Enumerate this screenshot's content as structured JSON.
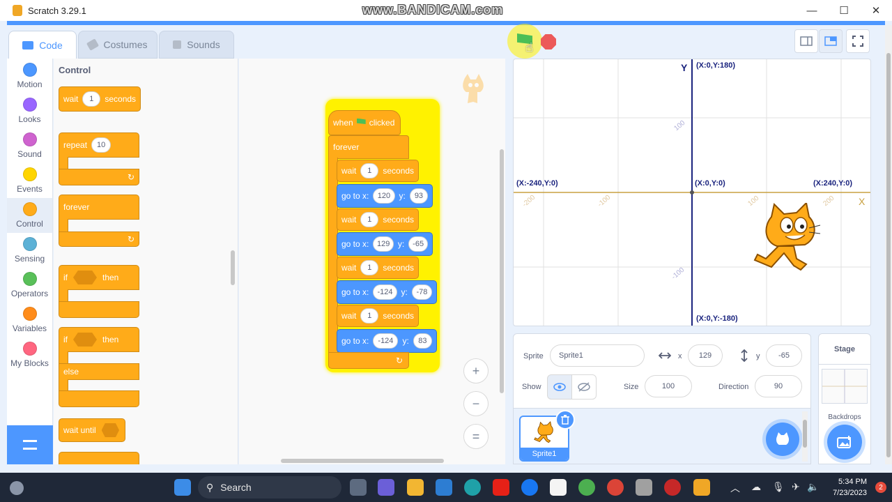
{
  "window": {
    "title": "Scratch 3.29.1",
    "watermark": "www.BANDICAM.com",
    "controls": {
      "minimize": "—",
      "maximize": "☐",
      "close": "✕"
    }
  },
  "tabs": [
    {
      "label": "Code",
      "icon": "code-icon"
    },
    {
      "label": "Costumes",
      "icon": "brush-icon"
    },
    {
      "label": "Sounds",
      "icon": "speaker-icon"
    }
  ],
  "categories": [
    {
      "label": "Motion",
      "color": "#4c97ff"
    },
    {
      "label": "Looks",
      "color": "#9966ff"
    },
    {
      "label": "Sound",
      "color": "#cf63cf"
    },
    {
      "label": "Events",
      "color": "#ffd500"
    },
    {
      "label": "Control",
      "color": "#ffab19"
    },
    {
      "label": "Sensing",
      "color": "#5cb1d6"
    },
    {
      "label": "Operators",
      "color": "#59c059"
    },
    {
      "label": "Variables",
      "color": "#ff8c1a"
    },
    {
      "label": "My Blocks",
      "color": "#ff6680"
    }
  ],
  "palette": {
    "title": "Control",
    "wait": {
      "pre": "wait",
      "value": "1",
      "post": "seconds"
    },
    "repeat": {
      "pre": "repeat",
      "value": "10"
    },
    "forever": "forever",
    "if_then": {
      "pre": "if",
      "post": "then"
    },
    "if_else": {
      "pre": "if",
      "post": "then",
      "else": "else"
    },
    "wait_until": "wait until",
    "loop_arrow": "↻"
  },
  "script": {
    "hat": {
      "pre": "when",
      "post": "clicked"
    },
    "forever": "forever",
    "wait_pre": "wait",
    "wait_post": "seconds",
    "goto_pre": "go to x:",
    "goto_y": "y:",
    "steps": [
      {
        "wait": "1",
        "x": "120",
        "y": "93"
      },
      {
        "wait": "1",
        "x": "129",
        "y": "-65"
      },
      {
        "wait": "1",
        "x": "-124",
        "y": "-78"
      },
      {
        "wait": "1",
        "x": "-124",
        "y": "83"
      }
    ],
    "loop_arrow": "↻"
  },
  "zoom": {
    "in": "+",
    "out": "−",
    "reset": "="
  },
  "stage": {
    "labels": {
      "y_axis": "Y",
      "x_axis": "X",
      "top": "(X:0,Y:180)",
      "bottom": "(X:0,Y:-180)",
      "left": "(X:-240,Y:0)",
      "right": "(X:240,Y:0)",
      "origin": "(X:0,Y:0)",
      "ticks": {
        "y100": "100",
        "y_100": "-100",
        "x_200": "-200",
        "x_100": "-100",
        "x100": "100",
        "x200": "200"
      }
    }
  },
  "sprite_info": {
    "sprite_label": "Sprite",
    "sprite_name": "Sprite1",
    "x_label": "x",
    "x_value": "129",
    "y_label": "y",
    "y_value": "-65",
    "show_label": "Show",
    "size_label": "Size",
    "size_value": "100",
    "direction_label": "Direction",
    "direction_value": "90"
  },
  "sprite_list": {
    "items": [
      {
        "name": "Sprite1"
      }
    ]
  },
  "stage_panel": {
    "title": "Stage",
    "backdrops_label": "Backdrops"
  },
  "taskbar": {
    "search_placeholder": "Search",
    "time": "5:34 PM",
    "date": "7/23/2023",
    "notifications": "2"
  }
}
